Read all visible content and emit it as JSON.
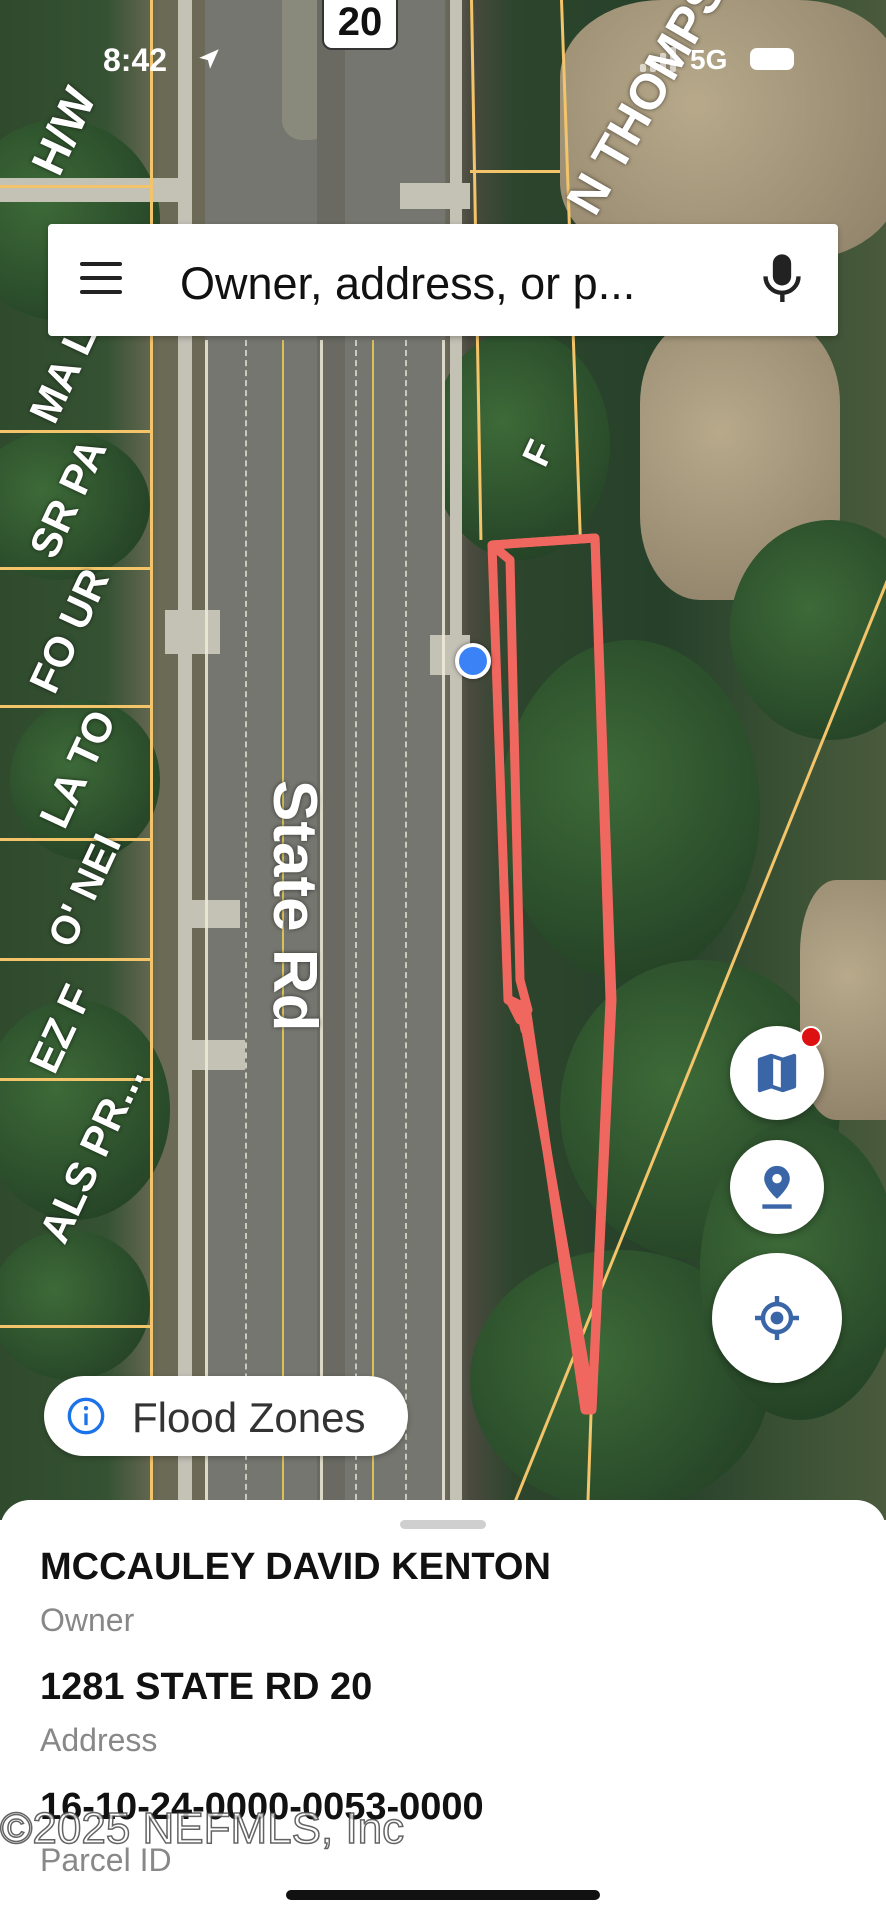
{
  "status_bar": {
    "time": "8:42",
    "network": "5G"
  },
  "map": {
    "route_shield": "20",
    "road_label": "State Rd",
    "street_label": "N THOMPS",
    "parcel_labels": [
      "H/W",
      "MA LD",
      "SR PA",
      "FO UR",
      "LA TO",
      "O' NEI",
      "EZ F",
      "ALS PR...",
      "F"
    ],
    "highlight_color": "#f0675f",
    "parcel_line_color": "#f3c46a"
  },
  "search": {
    "placeholder": "Owner, address, or p..."
  },
  "chips": {
    "flood_zones": "Flood Zones"
  },
  "detail_sheet": {
    "owner_value": "MCCAULEY DAVID KENTON",
    "owner_label": "Owner",
    "address_value": "1281 STATE RD 20",
    "address_label": "Address",
    "parcel_value": "16-10-24-0000-0053-0000",
    "parcel_label": "Parcel ID"
  },
  "watermark": "©2025 NEFMLS, Inc",
  "icons": [
    "menu-icon",
    "mic-icon",
    "map-layers-icon",
    "pin-icon",
    "my-location-icon",
    "info-icon"
  ],
  "accent_color": "#1a73e8"
}
